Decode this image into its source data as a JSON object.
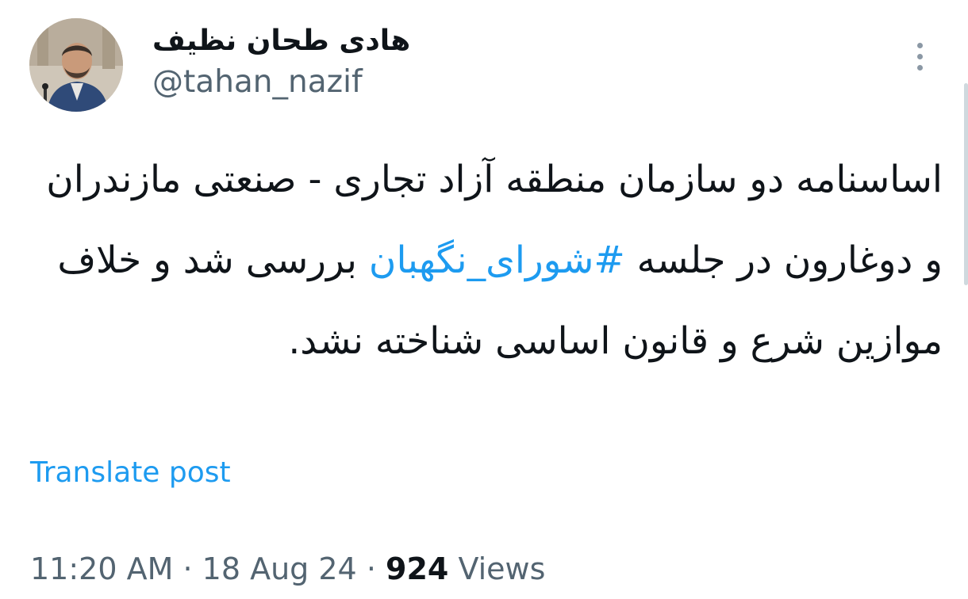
{
  "author": {
    "display_name": "هادی طحان نظیف",
    "handle": "@tahan_nazif"
  },
  "post": {
    "text_before": "اساسنامه دو سازمان منطقه آزاد تجاری - صنعتی مازندران و دوغارون در جلسه ",
    "hashtag": "#شورای_نگهبان",
    "text_after": " بررسی شد و خلاف موازین شرع و قانون اساسی شناخته نشد."
  },
  "translate_label": "Translate post",
  "meta": {
    "time": "11:20 AM",
    "separator": "·",
    "date": "18 Aug 24",
    "views_count": "924",
    "views_label": "Views"
  },
  "icons": {
    "more": "more-vertical-icon",
    "avatar": "profile-photo"
  },
  "colors": {
    "text": "#0f1419",
    "secondary": "#536471",
    "link": "#1d9bf0"
  }
}
